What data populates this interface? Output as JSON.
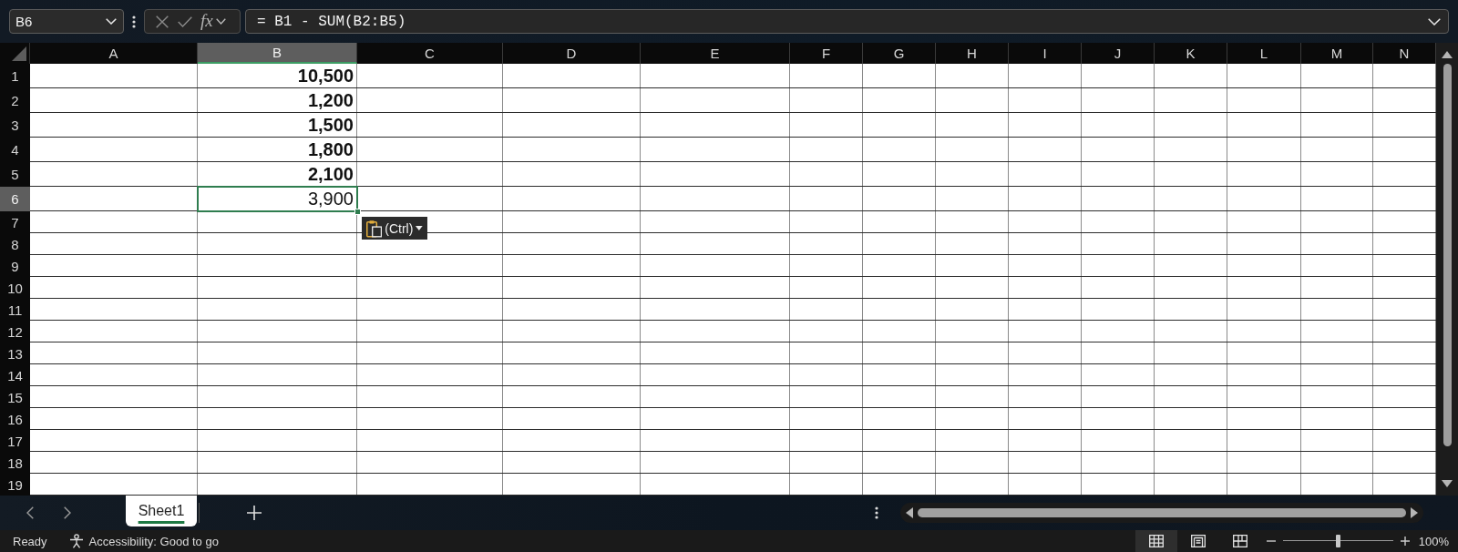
{
  "name_box": {
    "value": "B6"
  },
  "formula_bar": {
    "function_label": "fx",
    "value": "= B1 - SUM(B2:B5)"
  },
  "columns": [
    {
      "label": "A",
      "selected": false
    },
    {
      "label": "B",
      "selected": true,
      "cells": [
        {
          "text": "10,500",
          "bold": true,
          "selected": false
        },
        {
          "text": "1,200",
          "bold": true,
          "selected": false
        },
        {
          "text": "1,500",
          "bold": true,
          "selected": false
        },
        {
          "text": "1,800",
          "bold": true,
          "selected": false
        },
        {
          "text": "2,100",
          "bold": true,
          "selected": false
        },
        {
          "text": "3,900",
          "bold": false,
          "selected": true
        }
      ]
    },
    {
      "label": "C",
      "selected": false
    },
    {
      "label": "D",
      "selected": false
    },
    {
      "label": "E",
      "selected": false
    },
    {
      "label": "F",
      "selected": false
    },
    {
      "label": "G",
      "selected": false
    },
    {
      "label": "H",
      "selected": false
    },
    {
      "label": "I",
      "selected": false
    },
    {
      "label": "J",
      "selected": false
    },
    {
      "label": "K",
      "selected": false
    },
    {
      "label": "L",
      "selected": false
    },
    {
      "label": "M",
      "selected": false
    },
    {
      "label": "N",
      "selected": false
    }
  ],
  "rows": [
    {
      "label": "1",
      "selected": false
    },
    {
      "label": "2",
      "selected": false
    },
    {
      "label": "3",
      "selected": false
    },
    {
      "label": "4",
      "selected": false
    },
    {
      "label": "5",
      "selected": false
    },
    {
      "label": "6",
      "selected": true
    },
    {
      "label": "7",
      "selected": false
    },
    {
      "label": "8",
      "selected": false
    },
    {
      "label": "9",
      "selected": false
    },
    {
      "label": "10",
      "selected": false
    },
    {
      "label": "11",
      "selected": false
    },
    {
      "label": "12",
      "selected": false
    },
    {
      "label": "13",
      "selected": false
    },
    {
      "label": "14",
      "selected": false
    },
    {
      "label": "15",
      "selected": false
    },
    {
      "label": "16",
      "selected": false
    },
    {
      "label": "17",
      "selected": false
    },
    {
      "label": "18",
      "selected": false
    },
    {
      "label": "19",
      "selected": false
    }
  ],
  "paste_options": {
    "label": "(Ctrl)"
  },
  "sheet_tabs": [
    {
      "label": "Sheet1",
      "selected": true
    }
  ],
  "status_bar": {
    "mode": "Ready",
    "accessibility": "Accessibility: Good to go",
    "views": [
      {
        "kind": "normal",
        "selected": true
      },
      {
        "kind": "page_layout",
        "selected": false
      },
      {
        "kind": "page_break",
        "selected": false
      }
    ],
    "zoom": {
      "level": 0.5,
      "reading": "100%"
    }
  }
}
